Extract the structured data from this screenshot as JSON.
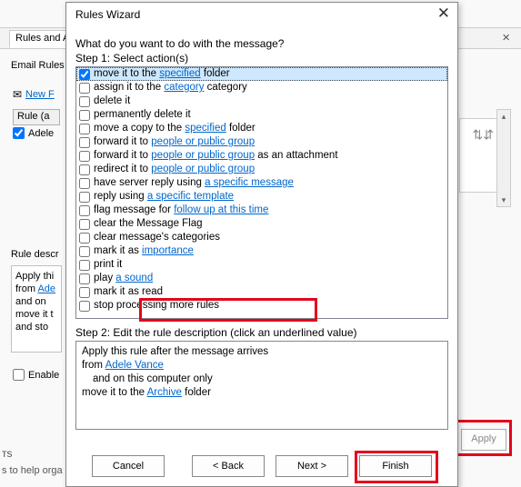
{
  "background": {
    "tab": "Rules and A",
    "close": "×",
    "section": "Email Rules",
    "newIcon": "✉",
    "newLink": "New F",
    "rulesHeader": "Rule (a",
    "ruleName": "Adele",
    "descLabel": "Rule descr",
    "descText": "Apply thi from Adel  and on move it t and sto",
    "descLine1": "Apply thi",
    "descLine2_pre": "from ",
    "descLine2_link": "Ade",
    "descLine3": "  and on",
    "descLine4": "move it t",
    "descLine5": "and sto",
    "enable": "Enable",
    "apply": "Apply",
    "trunc": "ᴛs",
    "help": "s to help orga",
    "scrollUp": "▴",
    "scrollDn": "▾",
    "previewIcon": "⇅⇵"
  },
  "dlg": {
    "title": "Rules Wizard",
    "close": "✕",
    "question": "What do you want to do with the message?",
    "step1": "Step 1: Select action(s)",
    "step2": "Step 2: Edit the rule description (click an underlined value)",
    "actions": [
      {
        "checked": true,
        "selected": true,
        "pre": "move it to the ",
        "link": "specified",
        "post": " folder"
      },
      {
        "checked": false,
        "pre": "assign it to the ",
        "link": "category",
        "post": " category"
      },
      {
        "checked": false,
        "pre": "delete it"
      },
      {
        "checked": false,
        "pre": "permanently delete it"
      },
      {
        "checked": false,
        "pre": "move a copy to the ",
        "link": "specified",
        "post": " folder"
      },
      {
        "checked": false,
        "pre": "forward it to ",
        "link": "people or public group"
      },
      {
        "checked": false,
        "pre": "forward it to ",
        "link": "people or public group",
        "post": " as an attachment"
      },
      {
        "checked": false,
        "pre": "redirect it to ",
        "link": "people or public group"
      },
      {
        "checked": false,
        "pre": "have server reply using ",
        "link": "a specific message"
      },
      {
        "checked": false,
        "pre": "reply using ",
        "link": "a specific template"
      },
      {
        "checked": false,
        "pre": "flag message for ",
        "link": "follow up at this time"
      },
      {
        "checked": false,
        "pre": "clear the Message Flag"
      },
      {
        "checked": false,
        "pre": "clear message's categories"
      },
      {
        "checked": false,
        "pre": "mark it as ",
        "link": "importance"
      },
      {
        "checked": false,
        "pre": "print it"
      },
      {
        "checked": false,
        "pre": "play ",
        "link": "a sound"
      },
      {
        "checked": false,
        "pre": "mark it as read"
      },
      {
        "checked": false,
        "pre": "stop processing more rules"
      }
    ],
    "desc": {
      "l1": "Apply this rule after the message arrives",
      "l2_pre": "from ",
      "l2_link": "Adele Vance",
      "l3": "and on this computer only",
      "l4_pre": "move it to the ",
      "l4_link": "Archive",
      "l4_post": " folder"
    },
    "buttons": {
      "cancel": "Cancel",
      "back": "< Back",
      "next": "Next >",
      "finish": "Finish"
    }
  }
}
